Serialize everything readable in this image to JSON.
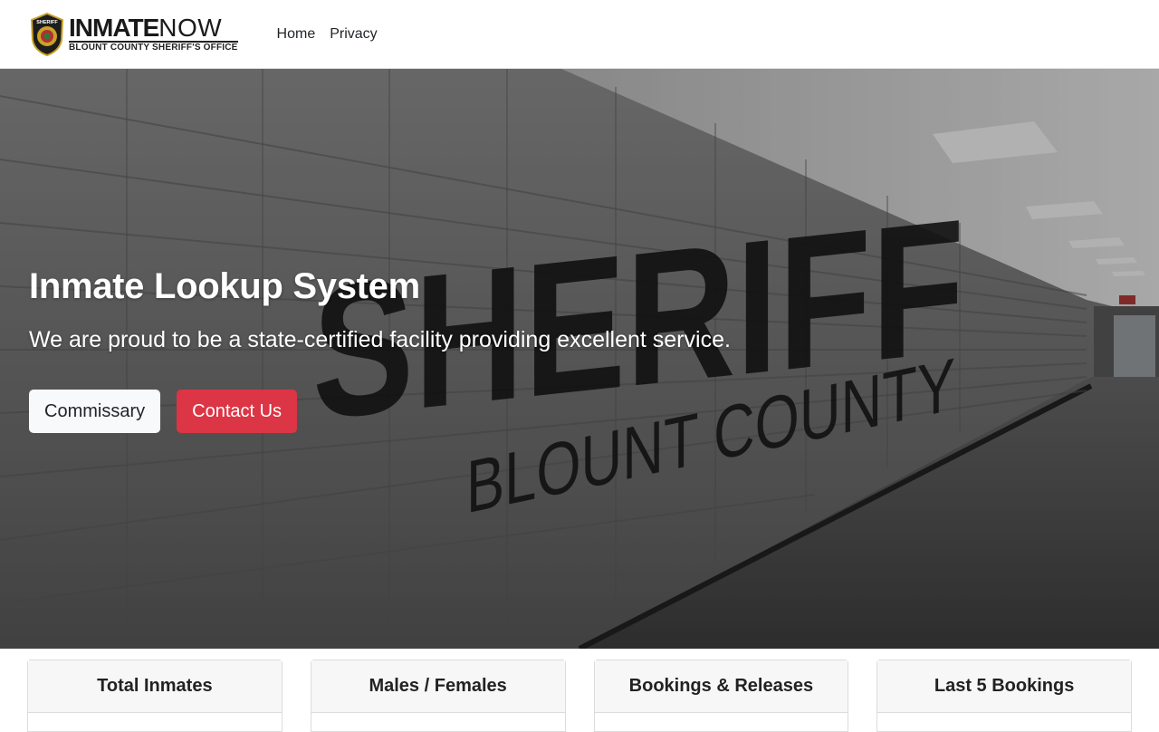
{
  "brand": {
    "name_bold": "INMATE",
    "name_light": "NOW",
    "subtitle": "BLOUNT COUNTY SHERIFF'S OFFICE",
    "badge_text": "SHERIFF"
  },
  "nav": {
    "links": [
      {
        "label": "Home"
      },
      {
        "label": "Privacy"
      }
    ]
  },
  "hero": {
    "title": "Inmate Lookup System",
    "tagline": "We are proud to be a state-certified facility providing excellent service.",
    "wall_text_main": "SHERIFF",
    "wall_text_sub": "BLOUNT COUNTY",
    "buttons": {
      "commissary": "Commissary",
      "contact": "Contact Us"
    }
  },
  "cards": [
    {
      "title": "Total Inmates"
    },
    {
      "title": "Males / Females"
    },
    {
      "title": "Bookings & Releases"
    },
    {
      "title": "Last 5 Bookings"
    }
  ],
  "colors": {
    "danger": "#dc3545",
    "light": "#f8f9fa"
  }
}
